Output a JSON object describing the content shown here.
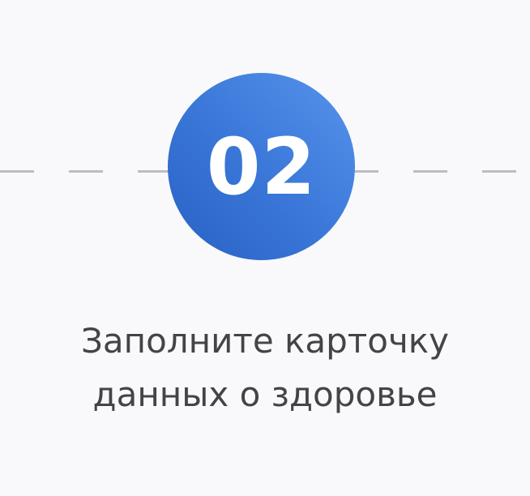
{
  "step": {
    "number": "02",
    "caption_lines": [
      "Заполните карточку",
      "данных о здоровье"
    ],
    "accent_color": "#3b78d9"
  }
}
